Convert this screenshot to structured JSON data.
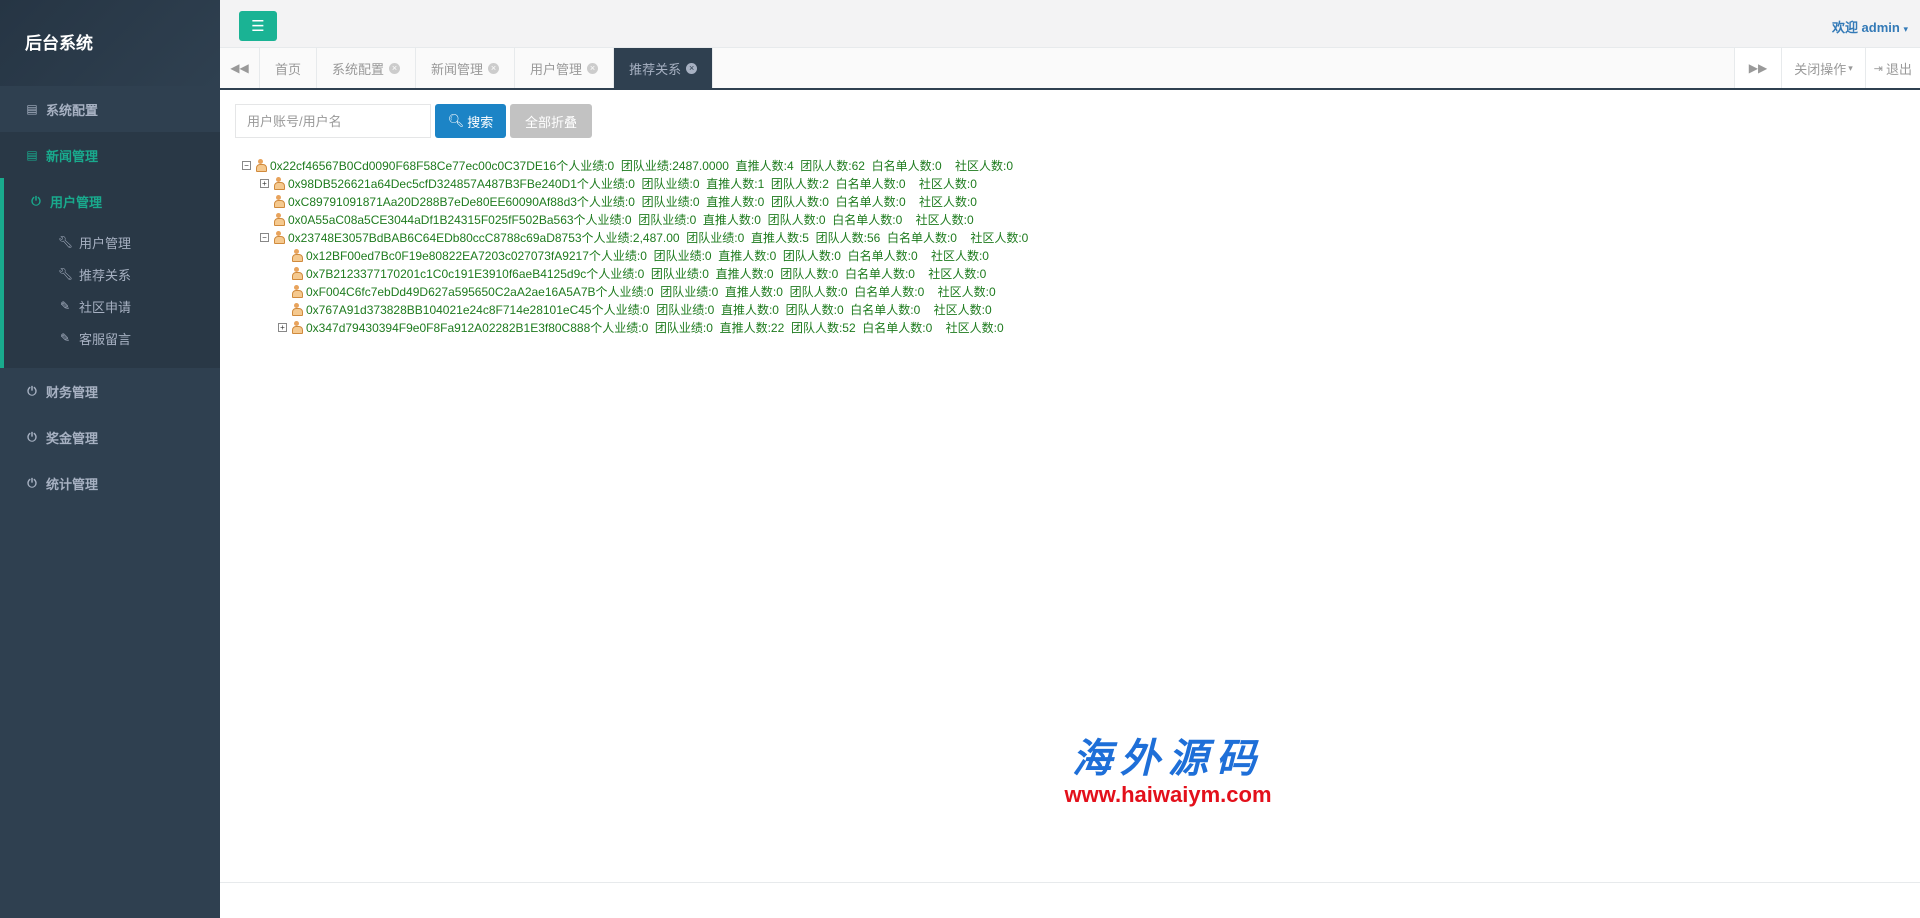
{
  "sidebar": {
    "brand": "后台系统",
    "items": [
      {
        "label": "系统配置",
        "icon": "document-icon"
      },
      {
        "label": "新闻管理",
        "icon": "document-icon"
      },
      {
        "label": "用户管理",
        "icon": "power-icon"
      }
    ],
    "sub_items": [
      {
        "label": "用户管理",
        "icon": "wrench-icon"
      },
      {
        "label": "推荐关系",
        "icon": "wrench-icon"
      },
      {
        "label": "社区申请",
        "icon": "edit-icon"
      },
      {
        "label": "客服留言",
        "icon": "edit-icon"
      }
    ],
    "bottom_items": [
      {
        "label": "财务管理",
        "icon": "power-icon"
      },
      {
        "label": "奖金管理",
        "icon": "power-icon"
      },
      {
        "label": "统计管理",
        "icon": "power-icon"
      }
    ]
  },
  "header": {
    "welcome": "欢迎 admin"
  },
  "tabs": {
    "items": [
      {
        "label": "首页",
        "closable": false
      },
      {
        "label": "系统配置",
        "closable": true
      },
      {
        "label": "新闻管理",
        "closable": true
      },
      {
        "label": "用户管理",
        "closable": true
      },
      {
        "label": "推荐关系",
        "closable": true,
        "active": true
      }
    ],
    "close_ops": "关闭操作",
    "logout": "退出"
  },
  "search": {
    "placeholder": "用户账号/用户名",
    "search_label": "搜索",
    "collapse_label": "全部折叠"
  },
  "tree": [
    {
      "level": 0,
      "toggle": "−",
      "text": "0x22cf46567B0Cd0090F68F58Ce77ec00c0C37DE16个人业绩:0  团队业绩:2487.0000  直推人数:4  团队人数:62  白名单人数:0    社区人数:0"
    },
    {
      "level": 1,
      "toggle": "+",
      "text": "0x98DB526621a64Dec5cfD324857A487B3FBe240D1个人业绩:0  团队业绩:0  直推人数:1  团队人数:2  白名单人数:0    社区人数:0"
    },
    {
      "level": 1,
      "toggle": "",
      "text": "0xC89791091871Aa20D288B7eDe80EE60090Af88d3个人业绩:0  团队业绩:0  直推人数:0  团队人数:0  白名单人数:0    社区人数:0"
    },
    {
      "level": 1,
      "toggle": "",
      "text": "0x0A55aC08a5CE3044aDf1B24315F025fF502Ba563个人业绩:0  团队业绩:0  直推人数:0  团队人数:0  白名单人数:0    社区人数:0"
    },
    {
      "level": 1,
      "toggle": "−",
      "text": "0x23748E3057BdBAB6C64EDb80ccC8788c69aD8753个人业绩:2,487.00  团队业绩:0  直推人数:5  团队人数:56  白名单人数:0    社区人数:0"
    },
    {
      "level": 2,
      "toggle": "",
      "text": "0x12BF00ed7Bc0F19e80822EA7203c027073fA9217个人业绩:0  团队业绩:0  直推人数:0  团队人数:0  白名单人数:0    社区人数:0"
    },
    {
      "level": 2,
      "toggle": "",
      "text": "0x7B2123377170201c1C0c191E3910f6aeB4125d9c个人业绩:0  团队业绩:0  直推人数:0  团队人数:0  白名单人数:0    社区人数:0"
    },
    {
      "level": 2,
      "toggle": "",
      "text": "0xF004C6fc7ebDd49D627a595650C2aA2ae16A5A7B个人业绩:0  团队业绩:0  直推人数:0  团队人数:0  白名单人数:0    社区人数:0"
    },
    {
      "level": 2,
      "toggle": "",
      "text": "0x767A91d373828BB104021e24c8F714e28101eC45个人业绩:0  团队业绩:0  直推人数:0  团队人数:0  白名单人数:0    社区人数:0"
    },
    {
      "level": 2,
      "toggle": "+",
      "text": "0x347d79430394F9e0F8Fa912A02282B1E3f80C888个人业绩:0  团队业绩:0  直推人数:22  团队人数:52  白名单人数:0    社区人数:0"
    }
  ],
  "watermark": {
    "cn": "海外源码",
    "url": "www.haiwaiym.com"
  }
}
